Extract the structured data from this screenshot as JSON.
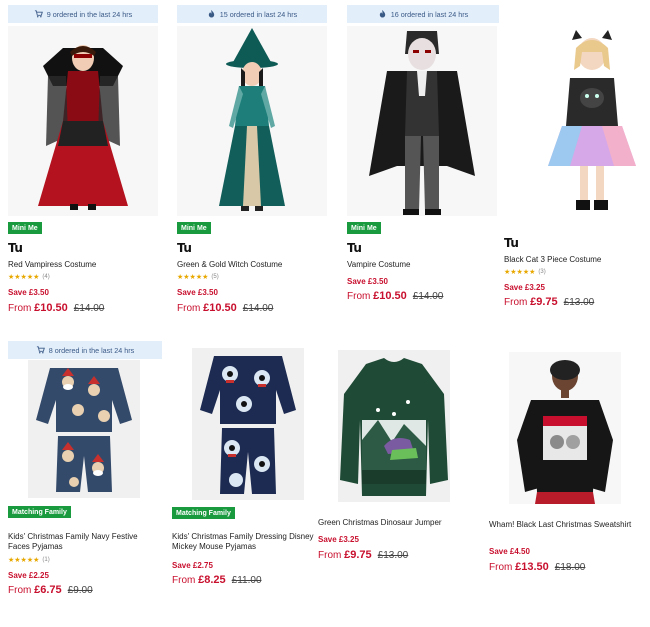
{
  "products": [
    {
      "banner": {
        "text": "9 ordered in the last 24 hrs",
        "icon": "basket-icon"
      },
      "badge": "Mini Me",
      "brand": "Tu",
      "title": "Red Vampiress Costume",
      "rating": 5,
      "rating_count": "(4)",
      "save": "Save £3.50",
      "from": "From",
      "price": "£10.50",
      "was": "£14.00"
    },
    {
      "banner": {
        "text": "15 ordered in last 24 hrs",
        "icon": "flame-icon"
      },
      "badge": "Mini Me",
      "brand": "Tu",
      "title": "Green & Gold Witch Costume",
      "rating": 5,
      "rating_count": "(5)",
      "save": "Save £3.50",
      "from": "From",
      "price": "£10.50",
      "was": "£14.00"
    },
    {
      "banner": {
        "text": "16 ordered in last 24 hrs",
        "icon": "flame-icon"
      },
      "badge": "Mini Me",
      "brand": "Tu",
      "title": "Vampire Costume",
      "save": "Save £3.50",
      "from": "From",
      "price": "£10.50",
      "was": "£14.00"
    },
    {
      "brand": "Tu",
      "title": "Black Cat 3 Piece Costume",
      "rating": 5,
      "rating_count": "(3)",
      "save": "Save £3.25",
      "from": "From",
      "price": "£9.75",
      "was": "£13.00"
    },
    {
      "banner": {
        "text": "8 ordered in the last 24 hrs",
        "icon": "basket-icon"
      },
      "badge": "Matching Family",
      "title": "Kids' Christmas Family Navy Festive Faces Pyjamas",
      "rating": 5,
      "rating_count": "(1)",
      "save": "Save £2.25",
      "from": "From",
      "price": "£6.75",
      "was": "£9.00"
    },
    {
      "badge": "Matching Family",
      "title": "Kids' Christmas Family Dressing Disney Mickey Mouse Pyjamas",
      "save": "Save £2.75",
      "from": "From",
      "price": "£8.25",
      "was": "£11.00"
    },
    {
      "title": "Green Christmas Dinosaur Jumper",
      "save": "Save £3.25",
      "from": "From",
      "price": "£9.75",
      "was": "£13.00"
    },
    {
      "title": "Wham! Black Last Christmas Sweatshirt",
      "save": "Save £4.50",
      "from": "From",
      "price": "£13.50",
      "was": "£18.00"
    }
  ],
  "colors": {
    "accent_red": "#c8102e",
    "badge_green": "#1a9a3f",
    "banner_bg": "#e3eefb",
    "star": "#e8a800"
  }
}
